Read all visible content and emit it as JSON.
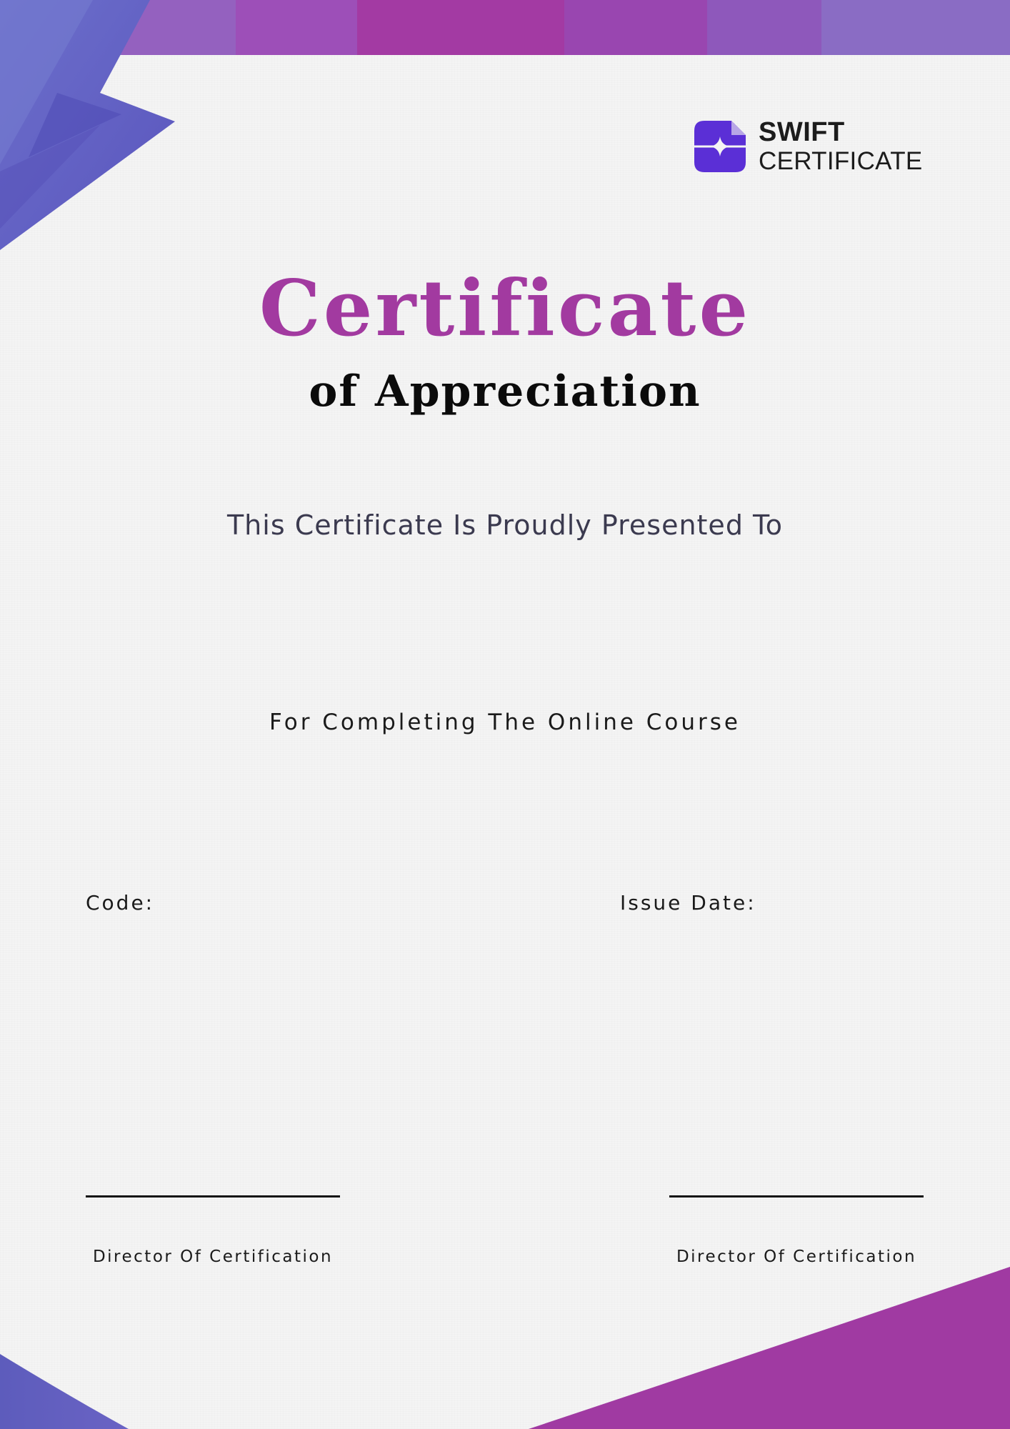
{
  "colors": {
    "accent_magenta": "#a23aa0",
    "accent_indigo": "#5a4fc0",
    "logo_purple": "#5b2fd6",
    "top_band": [
      "#8a6fc6",
      "#9a5bbf",
      "#a448b4",
      "#a33aa3",
      "#9946b0",
      "#8e5bbd",
      "#8a6cc4"
    ]
  },
  "logo": {
    "icon": "swift-certificate-logo-icon",
    "line1": "SWIFT",
    "line2": "CERTIFICATE"
  },
  "certificate": {
    "title": "Certificate",
    "subtitle": "of Appreciation",
    "presented_text": "This Certificate Is Proudly Presented To",
    "course_text": "For Completing The Online Course"
  },
  "details": {
    "code_label": "Code:",
    "issue_date_label": "Issue Date:"
  },
  "signatures": [
    {
      "title": "Director Of Certification"
    },
    {
      "title": "Director Of Certification"
    }
  ]
}
